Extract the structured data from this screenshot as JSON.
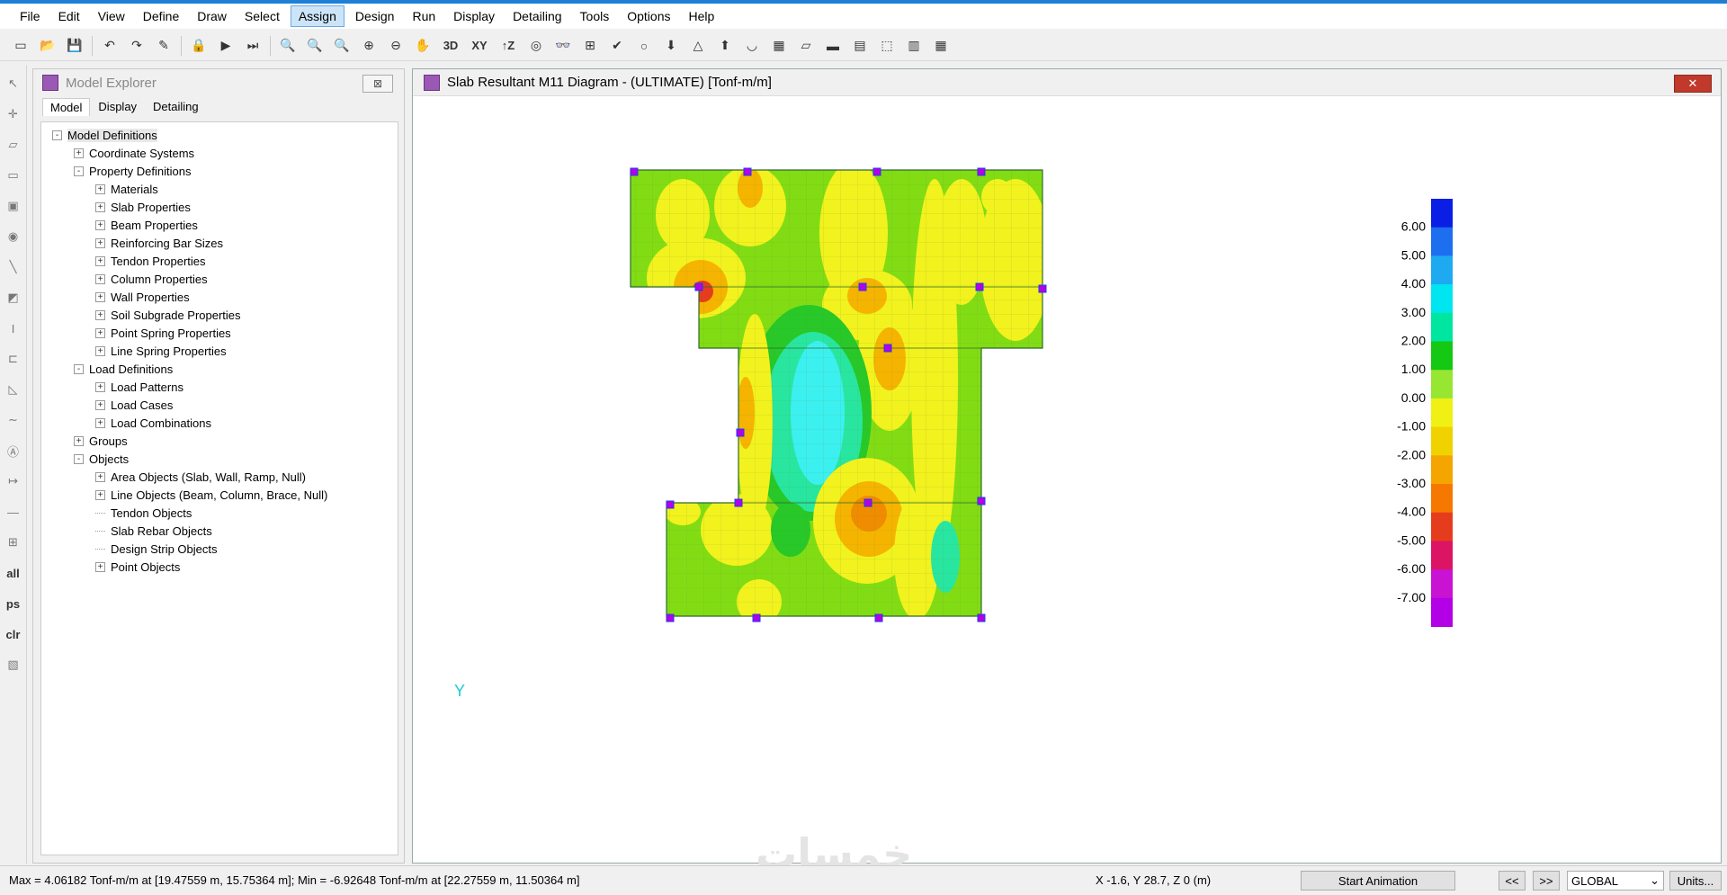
{
  "menu": [
    "File",
    "Edit",
    "View",
    "Define",
    "Draw",
    "Select",
    "Assign",
    "Design",
    "Run",
    "Display",
    "Detailing",
    "Tools",
    "Options",
    "Help"
  ],
  "menu_active": "Assign",
  "toolbar_text_buttons": {
    "three_d": "3D",
    "xy": "XY",
    "z": "↑Z"
  },
  "left_tools": {
    "all": "all",
    "ps": "ps",
    "clr": "clr"
  },
  "explorer": {
    "title": "Model Explorer",
    "tabs": [
      "Model",
      "Display",
      "Detailing"
    ],
    "active_tab": "Model",
    "tree": [
      {
        "label": "Model Definitions",
        "level": 0,
        "toggle": "-",
        "selected": true
      },
      {
        "label": "Coordinate Systems",
        "level": 1,
        "toggle": "+"
      },
      {
        "label": "Property Definitions",
        "level": 1,
        "toggle": "-"
      },
      {
        "label": "Materials",
        "level": 2,
        "toggle": "+"
      },
      {
        "label": "Slab Properties",
        "level": 2,
        "toggle": "+"
      },
      {
        "label": "Beam Properties",
        "level": 2,
        "toggle": "+"
      },
      {
        "label": "Reinforcing Bar Sizes",
        "level": 2,
        "toggle": "+"
      },
      {
        "label": "Tendon Properties",
        "level": 2,
        "toggle": "+"
      },
      {
        "label": "Column Properties",
        "level": 2,
        "toggle": "+"
      },
      {
        "label": "Wall Properties",
        "level": 2,
        "toggle": "+"
      },
      {
        "label": "Soil Subgrade Properties",
        "level": 2,
        "toggle": "+"
      },
      {
        "label": "Point Spring Properties",
        "level": 2,
        "toggle": "+"
      },
      {
        "label": "Line Spring Properties",
        "level": 2,
        "toggle": "+"
      },
      {
        "label": "Load Definitions",
        "level": 1,
        "toggle": "-"
      },
      {
        "label": "Load Patterns",
        "level": 2,
        "toggle": "+"
      },
      {
        "label": "Load Cases",
        "level": 2,
        "toggle": "+"
      },
      {
        "label": "Load Combinations",
        "level": 2,
        "toggle": "+"
      },
      {
        "label": "Groups",
        "level": 1,
        "toggle": "+"
      },
      {
        "label": "Objects",
        "level": 1,
        "toggle": "-"
      },
      {
        "label": "Area Objects (Slab, Wall, Ramp, Null)",
        "level": 2,
        "toggle": "+"
      },
      {
        "label": "Line Objects (Beam, Column, Brace, Null)",
        "level": 2,
        "toggle": "+"
      },
      {
        "label": "Tendon Objects",
        "level": 2,
        "toggle": ""
      },
      {
        "label": "Slab Rebar Objects",
        "level": 2,
        "toggle": ""
      },
      {
        "label": "Design Strip Objects",
        "level": 2,
        "toggle": ""
      },
      {
        "label": "Point Objects",
        "level": 2,
        "toggle": "+"
      }
    ]
  },
  "graph": {
    "title": "Slab Resultant M11 Diagram - (ULTIMATE)  [Tonf-m/m]",
    "axis_label": "Y",
    "legend": {
      "labels": [
        "6.00",
        "5.00",
        "4.00",
        "3.00",
        "2.00",
        "1.00",
        "0.00",
        "-1.00",
        "-2.00",
        "-3.00",
        "-4.00",
        "-5.00",
        "-6.00",
        "-7.00"
      ],
      "colors": [
        "#0a1ee6",
        "#1e6ef0",
        "#1eaaf0",
        "#00e6f0",
        "#00e6a0",
        "#14c814",
        "#96e632",
        "#f0f014",
        "#f0d200",
        "#f5a500",
        "#f57800",
        "#e63c1e",
        "#dc1464",
        "#c814d2",
        "#b400e6"
      ]
    },
    "colors": {
      "yellow": "#f2f21e",
      "green": "#82dc14",
      "deepgreen": "#28c828",
      "orange": "#f5b400",
      "darkorange": "#f08c00",
      "red": "#e63c1e",
      "cyan": "#3cf0f0",
      "teal": "#28e6a0",
      "purple": "#b400e6",
      "blue": "#1e3cf0"
    }
  },
  "status": {
    "message": "Max = 4.06182 Tonf-m/m at [19.47559 m, 15.75364 m];  Min = -6.92648 Tonf-m/m at [22.27559 m, 11.50364 m]",
    "coords": "X -1.6,  Y 28.7,  Z 0  (m)",
    "start_animation": "Start Animation",
    "prev": "<<",
    "next": ">>",
    "coord_system": "GLOBAL",
    "units": "Units..."
  }
}
